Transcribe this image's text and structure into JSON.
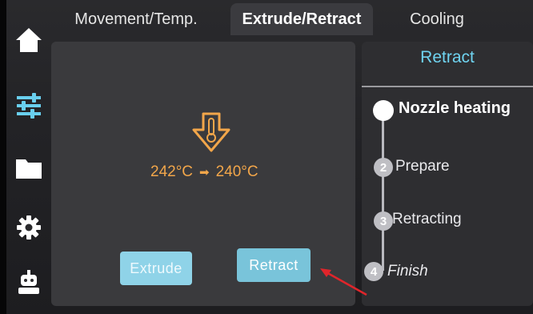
{
  "sidebar": {
    "items": [
      {
        "name": "home",
        "icon": "home-icon"
      },
      {
        "name": "controls",
        "icon": "sliders-icon",
        "selected": true
      },
      {
        "name": "files",
        "icon": "folder-icon"
      },
      {
        "name": "settings",
        "icon": "gear-icon"
      },
      {
        "name": "device",
        "icon": "robot-icon"
      }
    ]
  },
  "tabs": [
    {
      "label": "Movement/Temp.",
      "active": false
    },
    {
      "label": "Extrude/Retract",
      "active": true
    },
    {
      "label": "Cooling",
      "active": false
    }
  ],
  "main": {
    "icon": "nozzle-heating-icon",
    "current_temp": "242°C",
    "target_temp": "240°C",
    "arrow": "➡",
    "extrude_label": "Extrude",
    "retract_label": "Retract"
  },
  "steps_panel": {
    "title": "Retract",
    "steps": [
      {
        "number": "",
        "label": "Nozzle heating",
        "current": true
      },
      {
        "number": "2",
        "label": "Prepare"
      },
      {
        "number": "3",
        "label": "Retracting"
      },
      {
        "number": "4",
        "label": "Finish"
      }
    ]
  },
  "colors": {
    "accent": "#6fd3f0",
    "temperature": "#f2a64a",
    "button": "#79c4da",
    "annotation_arrow": "#e0252b"
  }
}
